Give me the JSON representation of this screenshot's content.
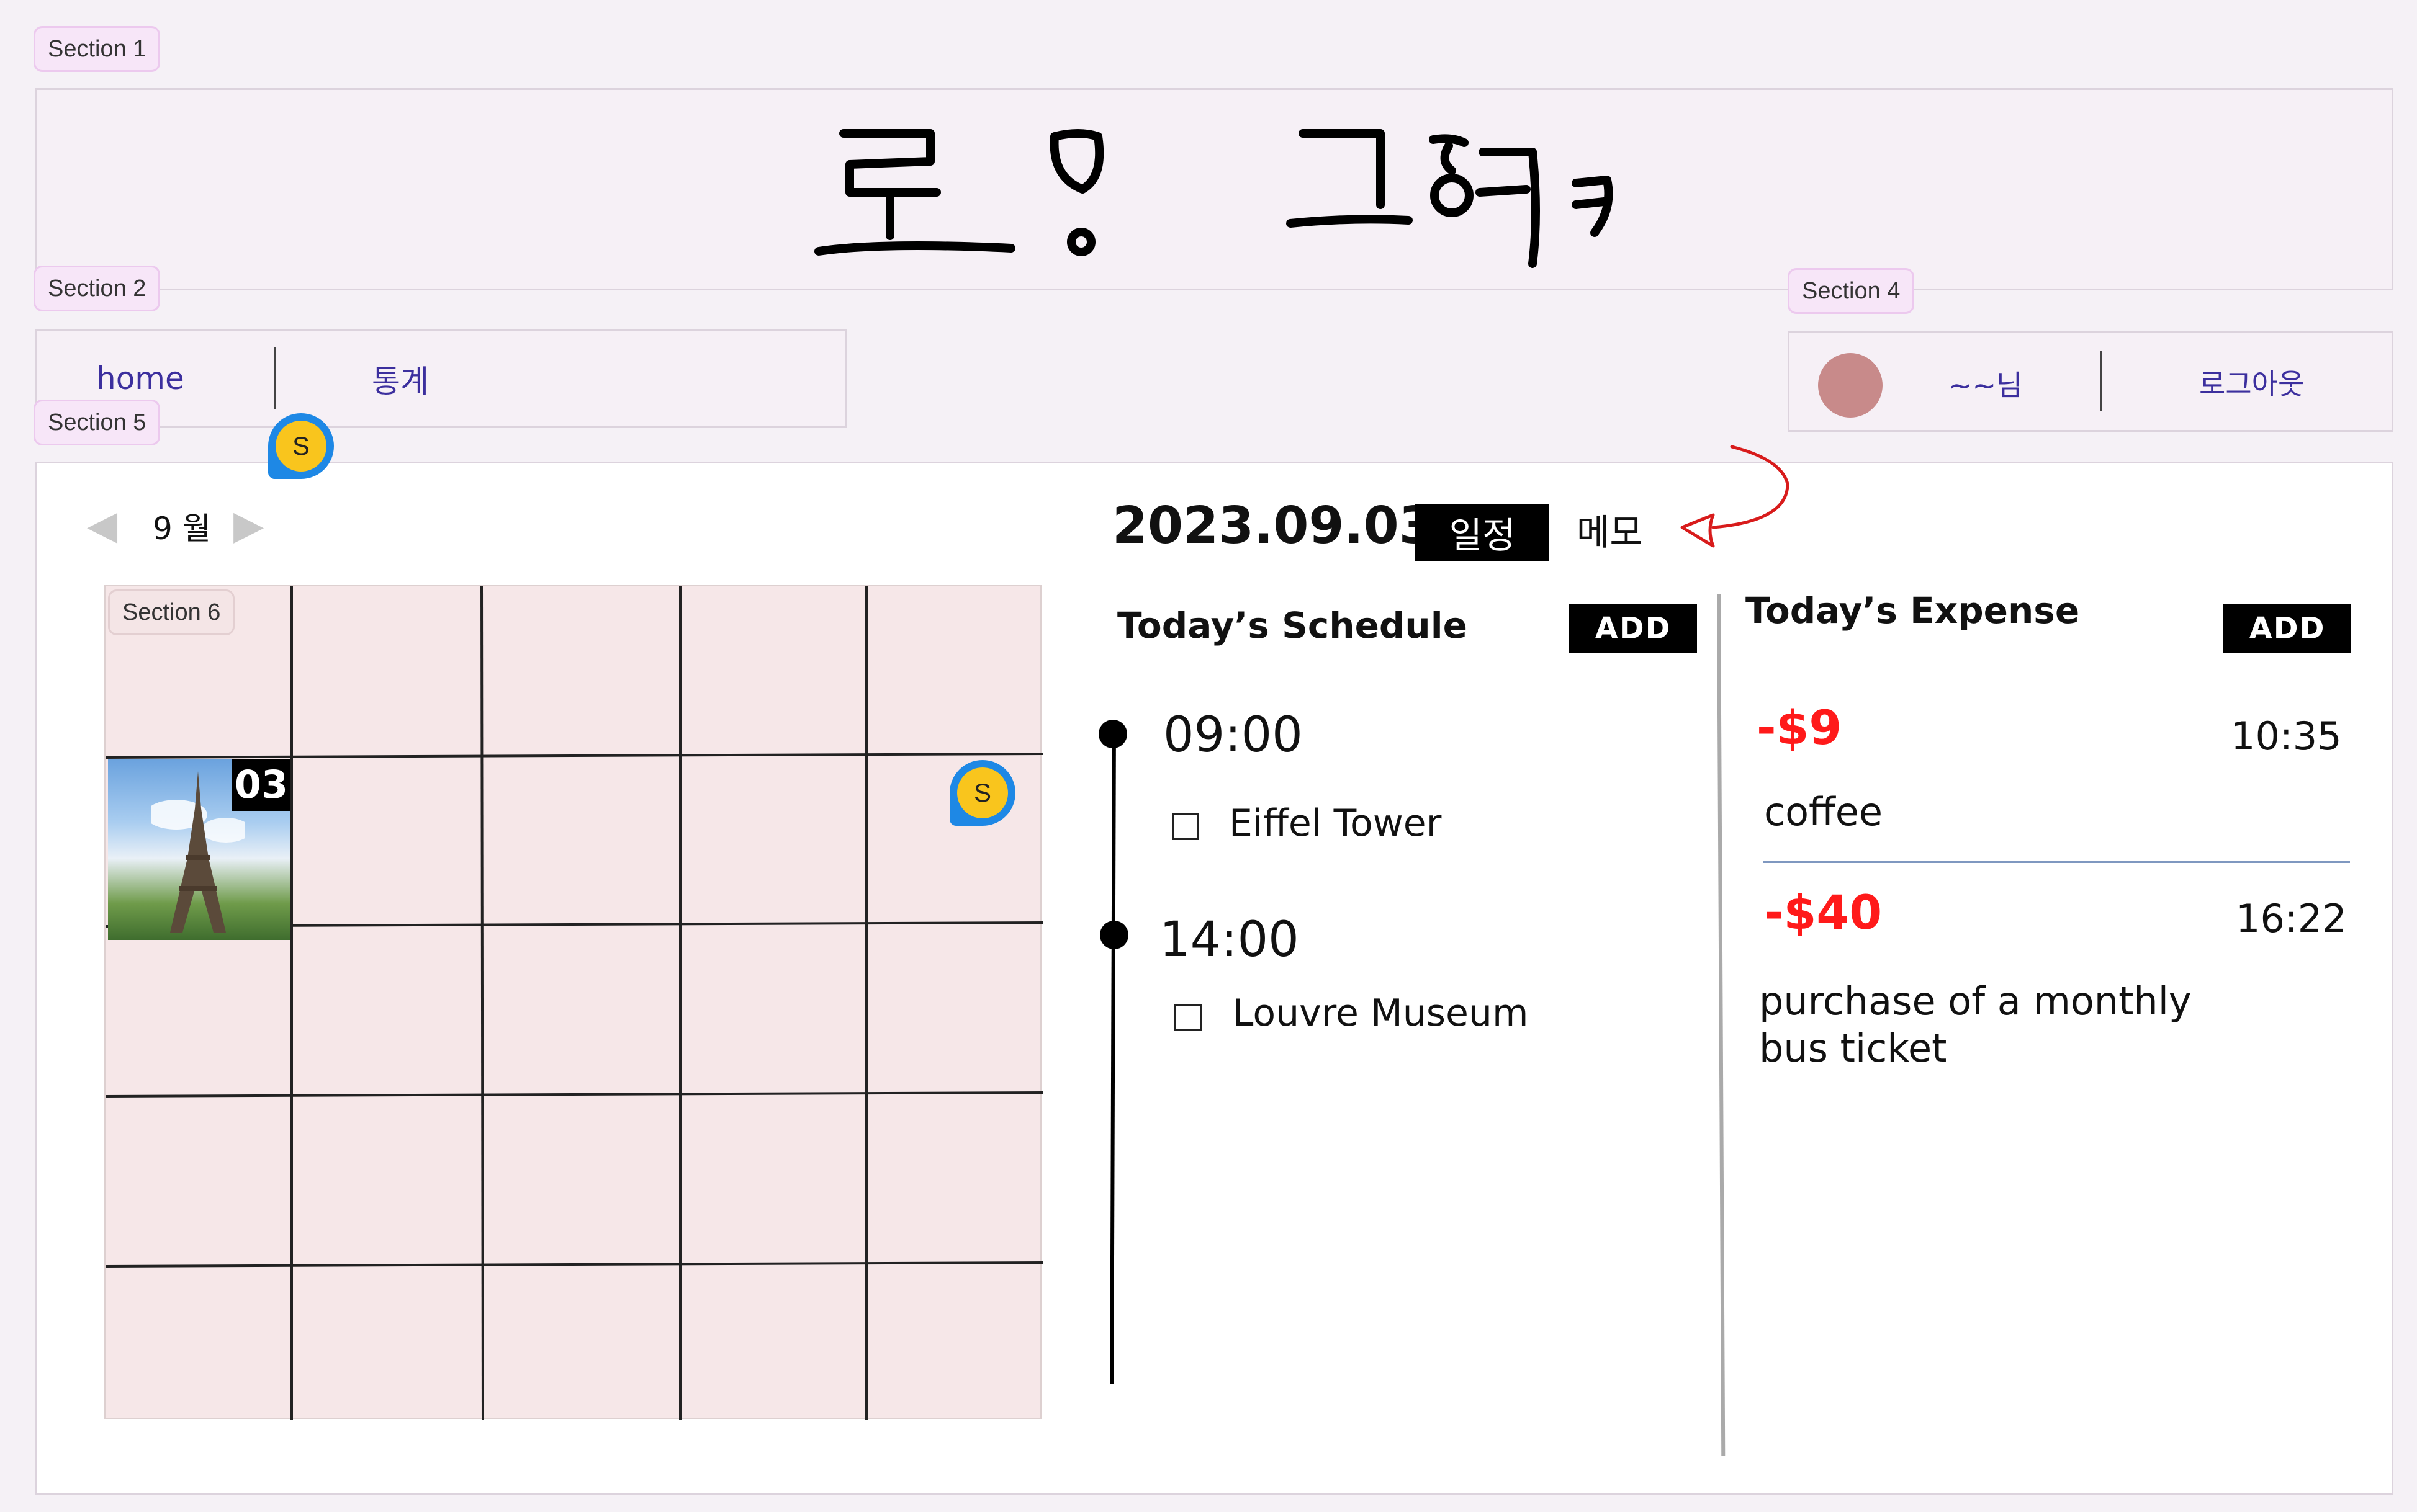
{
  "sections": {
    "s1": "Section 1",
    "s2": "Section 2",
    "s4": "Section 4",
    "s5": "Section 5",
    "s6": "Section 6"
  },
  "header": {
    "logo_text": "로그 고잉카"
  },
  "nav": {
    "home": "home",
    "stats": "통계"
  },
  "user": {
    "name": "~~님",
    "logout": "로그아웃",
    "avatar_color": "#c88a8a"
  },
  "pins": {
    "label": "S"
  },
  "calendar": {
    "month_label": "9 월",
    "prev_icon": "◀",
    "next_icon": "▶",
    "highlight_day": "03",
    "cols": 5,
    "rows": 5
  },
  "day": {
    "date": "2023.09.03",
    "tab_schedule": "일정",
    "tab_memo": "메모"
  },
  "schedule": {
    "title": "Today’s Schedule",
    "add_label": "ADD",
    "items": [
      {
        "time": "09:00",
        "task": "Eiffel Tower"
      },
      {
        "time": "14:00",
        "task": "Louvre Museum"
      }
    ]
  },
  "expense": {
    "title": "Today’s Expense",
    "add_label": "ADD",
    "items": [
      {
        "amount": "-$9",
        "time": "10:35",
        "desc": "coffee"
      },
      {
        "amount": "-$40",
        "time": "16:22",
        "desc": "purchase of a monthly bus ticket"
      }
    ]
  },
  "colors": {
    "accent_red": "#ff1a1a",
    "nav_link": "#3c2f9e",
    "section_tag": "#f7e6f8"
  }
}
